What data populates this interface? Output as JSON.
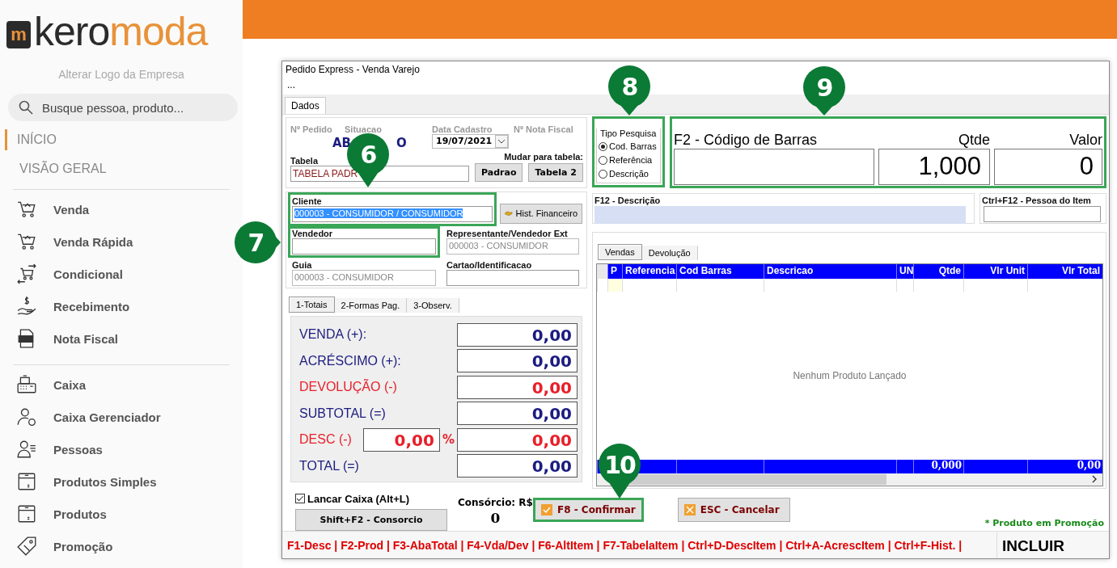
{
  "sidebar": {
    "logo": {
      "badge": "m",
      "part_1": "kero",
      "part_2": "moda"
    },
    "change_logo": "Alterar Logo da Empresa",
    "search": {
      "placeholder": "Busque pessoa, produto..."
    },
    "nav": [
      {
        "label": "INÍCIO",
        "selected": true
      },
      {
        "label": "VISÃO GERAL",
        "selected": false
      }
    ],
    "menu_groups": [
      [
        "Venda",
        "Venda Rápida",
        "Condicional",
        "Recebimento",
        "Nota Fiscal"
      ],
      [
        "Caixa",
        "Caixa Gerenciador",
        "Pessoas",
        "Produtos Simples",
        "Produtos",
        "Promoção"
      ]
    ]
  },
  "dialog": {
    "title": "Pedido Express - Venda Varejo",
    "menu": "...",
    "tabs": [
      {
        "label": "Dados",
        "selected": true
      }
    ],
    "header": {
      "labels": [
        "Nº Pedido",
        "Situacao",
        "Data Cadastro",
        "Nº Nota Fiscal"
      ],
      "situacao_parts": [
        "AB",
        "O"
      ],
      "data_cadastro": "19/07/2021",
      "tabela_label": "Tabela",
      "tabela_value": "TABELA PADR",
      "change_table_label": "Mudar para tabela:",
      "table_buttons": [
        "Padrao",
        "Tabela 2"
      ]
    },
    "cliente": {
      "label": "Cliente",
      "value": "000003 - CONSUMIDOR / CONSUMIDOR",
      "highlighted": true,
      "history_button": "Hist. Financeiro"
    },
    "people_fields": [
      {
        "label": "Vendedor",
        "highlighted": true,
        "disabled": false
      },
      {
        "label": "Representante/Vendedor Ext",
        "value": "000003 - CONSUMIDOR",
        "highlighted": false,
        "disabled": true
      },
      {
        "label": "Guia",
        "value": "000003 - CONSUMIDOR",
        "highlighted": false,
        "disabled": true
      },
      {
        "label": "Cartao/Identificacao",
        "highlighted": false,
        "disabled": false
      }
    ],
    "totals_tabs": [
      {
        "label": "1-Totais",
        "selected": true
      },
      {
        "label": "2-Formas Pag.",
        "selected": false
      },
      {
        "label": "3-Observ.",
        "selected": false
      }
    ],
    "totals": [
      {
        "kind": "amount",
        "label": "VENDA (+):",
        "value": "0,00",
        "color": "#1c1c80"
      },
      {
        "kind": "amount",
        "label": "ACRÉSCIMO (+):",
        "value": "0,00",
        "color": "#1c1c80"
      },
      {
        "kind": "amount",
        "label": "DEVOLUÇÃO (-)",
        "value": "0,00",
        "color": "#e8202a"
      },
      {
        "kind": "amount",
        "label": "SUBTOTAL (=)",
        "value": "0,00",
        "color": "#1c1c80"
      },
      {
        "kind": "percent",
        "label": "DESC (-)",
        "percent_value": "0,00",
        "percent_sign": "%",
        "value": "0,00",
        "color": "#e8202a"
      },
      {
        "kind": "amount",
        "label": "TOTAL  (=)",
        "value": "0,00",
        "color": "#1c1c80"
      }
    ],
    "lancar_caixa": {
      "label": "Lancar Caixa (Alt+L)",
      "checked": true
    },
    "consorcio_button": "Shift+F2 - Consorcio",
    "consorcio": {
      "label": "Consórcio: R$",
      "value": "0"
    },
    "search_type": {
      "legend": "Tipo Pesquisa",
      "highlighted": true,
      "options": [
        {
          "label": "Cod. Barras",
          "selected": true
        },
        {
          "label": "Referência",
          "selected": false
        },
        {
          "label": "Descrição",
          "selected": false
        }
      ]
    },
    "entry": {
      "highlighted": true,
      "barcode_label": "F2 - Código de Barras",
      "qty_label": "Qtde",
      "qty_value": "1,000",
      "value_label": "Valor",
      "value": "0"
    },
    "description": {
      "label": "F12 - Descrição"
    },
    "item_person": {
      "label": "Ctrl+F12 - Pessoa do Item"
    },
    "items_tabs": [
      {
        "label": "Vendas",
        "selected": true
      },
      {
        "label": "Devolução",
        "selected": false
      }
    ],
    "items_table": {
      "columns": [
        "P",
        "Referencia",
        "Cod Barras",
        "Descricao",
        "UN",
        "Qtde",
        "Vlr Unit",
        "Vlr Total"
      ],
      "empty_message": "Nenhum Produto Lançado",
      "qty_total": "0,000",
      "amount_total": "0,00"
    },
    "buttons": [
      {
        "kind": "confirm",
        "label": "F8 - Confirmar",
        "highlighted": true
      },
      {
        "kind": "cancel",
        "label": "ESC - Cancelar",
        "highlighted": false
      }
    ],
    "promo_note": "* Produto em Promoção",
    "shortcuts": "F1-Desc | F2-Prod | F3-AbaTotal | F4-Vda/Dev | F6-AltItem | F7-TabelaItem | Ctrl+D-DescItem | Ctrl+A-AcrescItem | Ctrl+F-Hist. |",
    "mode": "INCLUIR"
  },
  "callouts": [
    "6",
    "7",
    "8",
    "9",
    "10"
  ]
}
